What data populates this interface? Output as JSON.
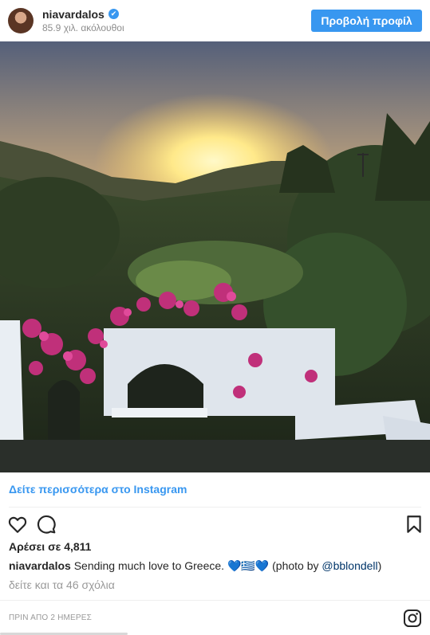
{
  "header": {
    "username": "niavardalos",
    "verified_mark": "✔",
    "followers": "85.9 χιλ. ακόλουθοι",
    "view_profile_label": "Προβολή προφίλ"
  },
  "photo": {
    "icon": "sunset-garden-photo"
  },
  "see_more_label": "Δείτε περισσότερα στο Instagram",
  "actions": {
    "like_icon": "heart-icon",
    "comment_icon": "comment-icon",
    "save_icon": "bookmark-icon"
  },
  "likes_text": "Αρέσει σε 4,811",
  "caption": {
    "username": "niavardalos",
    "text_before": "Sending much love to Greece. 💙🇬🇷💙 (photo by ",
    "mention": "@bblondell",
    "text_after": ")"
  },
  "comments_link": "δείτε και τα 46 σχόλια",
  "timestamp": "ΠΡΙΝ ΑΠΟ 2 ΗΜΕΡΕΣ",
  "colors": {
    "accent": "#3897f0",
    "text": "#262626",
    "muted": "#999999"
  }
}
